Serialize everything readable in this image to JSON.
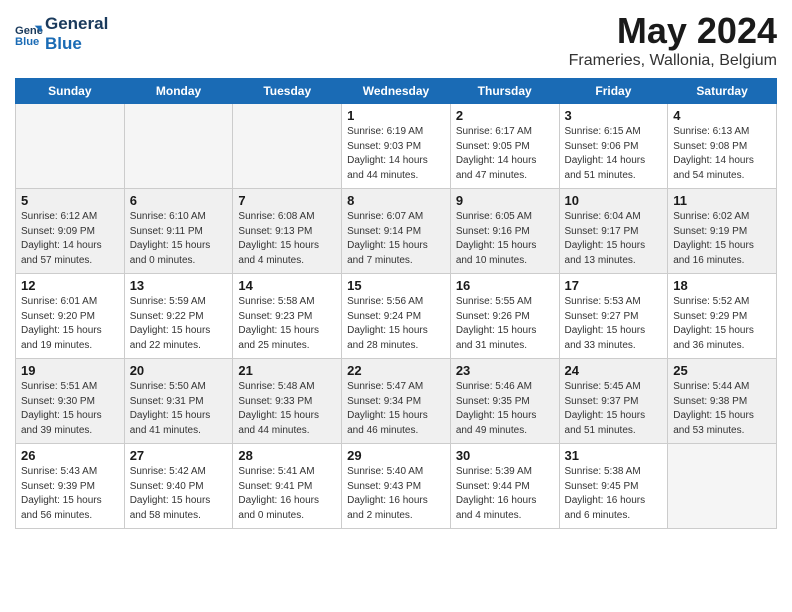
{
  "header": {
    "logo_line1": "General",
    "logo_line2": "Blue",
    "month_title": "May 2024",
    "location": "Frameries, Wallonia, Belgium"
  },
  "days_of_week": [
    "Sunday",
    "Monday",
    "Tuesday",
    "Wednesday",
    "Thursday",
    "Friday",
    "Saturday"
  ],
  "weeks": [
    [
      {
        "day": "",
        "empty": true,
        "shaded": false
      },
      {
        "day": "",
        "empty": true,
        "shaded": false
      },
      {
        "day": "",
        "empty": true,
        "shaded": false
      },
      {
        "day": "1",
        "empty": false,
        "shaded": false,
        "sunrise": "6:19 AM",
        "sunset": "9:03 PM",
        "daylight": "14 hours and 44 minutes."
      },
      {
        "day": "2",
        "empty": false,
        "shaded": false,
        "sunrise": "6:17 AM",
        "sunset": "9:05 PM",
        "daylight": "14 hours and 47 minutes."
      },
      {
        "day": "3",
        "empty": false,
        "shaded": false,
        "sunrise": "6:15 AM",
        "sunset": "9:06 PM",
        "daylight": "14 hours and 51 minutes."
      },
      {
        "day": "4",
        "empty": false,
        "shaded": false,
        "sunrise": "6:13 AM",
        "sunset": "9:08 PM",
        "daylight": "14 hours and 54 minutes."
      }
    ],
    [
      {
        "day": "5",
        "empty": false,
        "shaded": true,
        "sunrise": "6:12 AM",
        "sunset": "9:09 PM",
        "daylight": "14 hours and 57 minutes."
      },
      {
        "day": "6",
        "empty": false,
        "shaded": true,
        "sunrise": "6:10 AM",
        "sunset": "9:11 PM",
        "daylight": "15 hours and 0 minutes."
      },
      {
        "day": "7",
        "empty": false,
        "shaded": true,
        "sunrise": "6:08 AM",
        "sunset": "9:13 PM",
        "daylight": "15 hours and 4 minutes."
      },
      {
        "day": "8",
        "empty": false,
        "shaded": true,
        "sunrise": "6:07 AM",
        "sunset": "9:14 PM",
        "daylight": "15 hours and 7 minutes."
      },
      {
        "day": "9",
        "empty": false,
        "shaded": true,
        "sunrise": "6:05 AM",
        "sunset": "9:16 PM",
        "daylight": "15 hours and 10 minutes."
      },
      {
        "day": "10",
        "empty": false,
        "shaded": true,
        "sunrise": "6:04 AM",
        "sunset": "9:17 PM",
        "daylight": "15 hours and 13 minutes."
      },
      {
        "day": "11",
        "empty": false,
        "shaded": true,
        "sunrise": "6:02 AM",
        "sunset": "9:19 PM",
        "daylight": "15 hours and 16 minutes."
      }
    ],
    [
      {
        "day": "12",
        "empty": false,
        "shaded": false,
        "sunrise": "6:01 AM",
        "sunset": "9:20 PM",
        "daylight": "15 hours and 19 minutes."
      },
      {
        "day": "13",
        "empty": false,
        "shaded": false,
        "sunrise": "5:59 AM",
        "sunset": "9:22 PM",
        "daylight": "15 hours and 22 minutes."
      },
      {
        "day": "14",
        "empty": false,
        "shaded": false,
        "sunrise": "5:58 AM",
        "sunset": "9:23 PM",
        "daylight": "15 hours and 25 minutes."
      },
      {
        "day": "15",
        "empty": false,
        "shaded": false,
        "sunrise": "5:56 AM",
        "sunset": "9:24 PM",
        "daylight": "15 hours and 28 minutes."
      },
      {
        "day": "16",
        "empty": false,
        "shaded": false,
        "sunrise": "5:55 AM",
        "sunset": "9:26 PM",
        "daylight": "15 hours and 31 minutes."
      },
      {
        "day": "17",
        "empty": false,
        "shaded": false,
        "sunrise": "5:53 AM",
        "sunset": "9:27 PM",
        "daylight": "15 hours and 33 minutes."
      },
      {
        "day": "18",
        "empty": false,
        "shaded": false,
        "sunrise": "5:52 AM",
        "sunset": "9:29 PM",
        "daylight": "15 hours and 36 minutes."
      }
    ],
    [
      {
        "day": "19",
        "empty": false,
        "shaded": true,
        "sunrise": "5:51 AM",
        "sunset": "9:30 PM",
        "daylight": "15 hours and 39 minutes."
      },
      {
        "day": "20",
        "empty": false,
        "shaded": true,
        "sunrise": "5:50 AM",
        "sunset": "9:31 PM",
        "daylight": "15 hours and 41 minutes."
      },
      {
        "day": "21",
        "empty": false,
        "shaded": true,
        "sunrise": "5:48 AM",
        "sunset": "9:33 PM",
        "daylight": "15 hours and 44 minutes."
      },
      {
        "day": "22",
        "empty": false,
        "shaded": true,
        "sunrise": "5:47 AM",
        "sunset": "9:34 PM",
        "daylight": "15 hours and 46 minutes."
      },
      {
        "day": "23",
        "empty": false,
        "shaded": true,
        "sunrise": "5:46 AM",
        "sunset": "9:35 PM",
        "daylight": "15 hours and 49 minutes."
      },
      {
        "day": "24",
        "empty": false,
        "shaded": true,
        "sunrise": "5:45 AM",
        "sunset": "9:37 PM",
        "daylight": "15 hours and 51 minutes."
      },
      {
        "day": "25",
        "empty": false,
        "shaded": true,
        "sunrise": "5:44 AM",
        "sunset": "9:38 PM",
        "daylight": "15 hours and 53 minutes."
      }
    ],
    [
      {
        "day": "26",
        "empty": false,
        "shaded": false,
        "sunrise": "5:43 AM",
        "sunset": "9:39 PM",
        "daylight": "15 hours and 56 minutes."
      },
      {
        "day": "27",
        "empty": false,
        "shaded": false,
        "sunrise": "5:42 AM",
        "sunset": "9:40 PM",
        "daylight": "15 hours and 58 minutes."
      },
      {
        "day": "28",
        "empty": false,
        "shaded": false,
        "sunrise": "5:41 AM",
        "sunset": "9:41 PM",
        "daylight": "16 hours and 0 minutes."
      },
      {
        "day": "29",
        "empty": false,
        "shaded": false,
        "sunrise": "5:40 AM",
        "sunset": "9:43 PM",
        "daylight": "16 hours and 2 minutes."
      },
      {
        "day": "30",
        "empty": false,
        "shaded": false,
        "sunrise": "5:39 AM",
        "sunset": "9:44 PM",
        "daylight": "16 hours and 4 minutes."
      },
      {
        "day": "31",
        "empty": false,
        "shaded": false,
        "sunrise": "5:38 AM",
        "sunset": "9:45 PM",
        "daylight": "16 hours and 6 minutes."
      },
      {
        "day": "",
        "empty": true,
        "shaded": false
      }
    ]
  ]
}
